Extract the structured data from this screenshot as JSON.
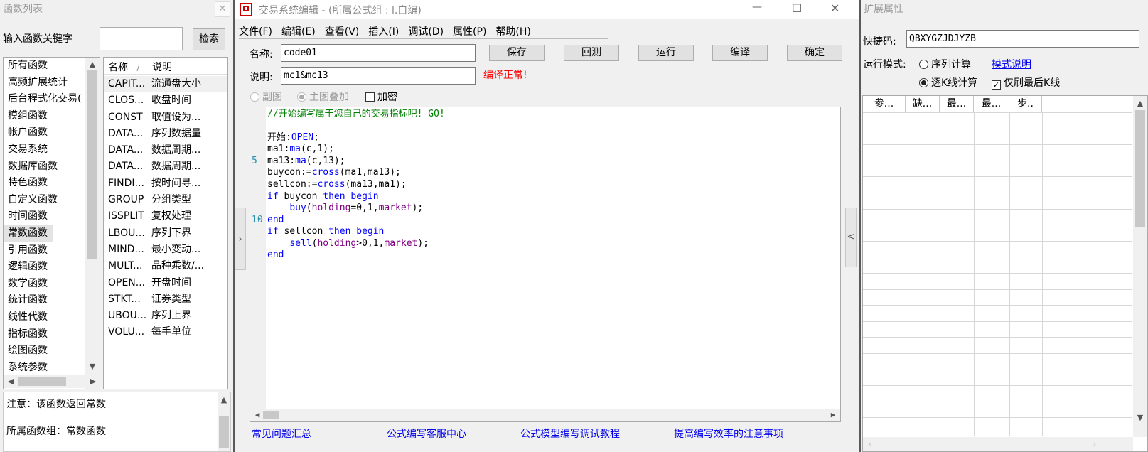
{
  "left_panel": {
    "title": "函数列表",
    "close_glyph": "✕",
    "keyword_label": "输入函数关键字",
    "keyword_value": "",
    "search_button": "检索",
    "categories": [
      "所有函数",
      "高频扩展统计",
      "后台程式化交易(",
      "模组函数",
      "帐户函数",
      "交易系统",
      "数据库函数",
      "特色函数",
      "自定义函数",
      "时间函数",
      "常数函数",
      "引用函数",
      "逻辑函数",
      "数学函数",
      "统计函数",
      "线性代数",
      "指标函数",
      "绘图函数",
      "系统参数"
    ],
    "selected_category": "常数函数",
    "columns": {
      "name": "名称",
      "sort_glyph": "/",
      "desc": "说明"
    },
    "functions": [
      {
        "name": "CAPIT...",
        "desc": "流通盘大小"
      },
      {
        "name": "CLOS...",
        "desc": "收盘时间"
      },
      {
        "name": "CONST",
        "desc": "取值设为..."
      },
      {
        "name": "DATA...",
        "desc": "序列数据量"
      },
      {
        "name": "DATA...",
        "desc": "数据周期..."
      },
      {
        "name": "DATA...",
        "desc": "数据周期..."
      },
      {
        "name": "FINDI...",
        "desc": "按时间寻..."
      },
      {
        "name": "GROUP",
        "desc": "分组类型"
      },
      {
        "name": "ISSPLIT",
        "desc": "复权处理"
      },
      {
        "name": "LBOU...",
        "desc": "序列下界"
      },
      {
        "name": "MIND...",
        "desc": "最小变动..."
      },
      {
        "name": "MULT...",
        "desc": "品种乘数/..."
      },
      {
        "name": "OPEN...",
        "desc": "开盘时间"
      },
      {
        "name": "STKT...",
        "desc": "证券类型"
      },
      {
        "name": "UBOU...",
        "desc": "序列上界"
      },
      {
        "name": "VOLU...",
        "desc": "每手单位"
      }
    ],
    "note_line1": "注意：该函数返回常数",
    "note_line2": "所属函数组：常数函数"
  },
  "editor": {
    "title": "交易系统编辑 - (所属公式组 : l.自编)",
    "window_controls": {
      "minimize": "—",
      "maximize": "☐",
      "close": "✕"
    },
    "menu": [
      "文件(F)",
      "编辑(E)",
      "查看(V)",
      "插入(I)",
      "调试(D)",
      "属性(P)",
      "帮助(H)"
    ],
    "name_label": "名称:",
    "name_value": "code01",
    "desc_label": "说明:",
    "desc_value": "mc1&mc13",
    "buttons": {
      "save": "保存",
      "backtest": "回测",
      "run": "运行",
      "compile": "编译",
      "ok": "确定"
    },
    "compile_status": "编译正常!",
    "options": {
      "sub_chart": "副图",
      "main_overlay": "主图叠加",
      "encrypt": "加密"
    },
    "line_numbers": [
      "5",
      "10"
    ],
    "expand_glyph": "<",
    "links": [
      "常见问题汇总",
      "公式编写客服中心",
      "公式模型编写调试教程",
      "提高编写效率的注意事项"
    ]
  },
  "right_panel": {
    "title": "扩展属性",
    "shortcut_label": "快捷码:",
    "shortcut_value": "QBXYGZJDJYZB",
    "mode_label": "运行模式:",
    "mode_seq": "序列计算",
    "mode_explain": "模式说明",
    "mode_bar": "逐K线计算",
    "refresh_last": "仅刷最后K线",
    "grid_headers": [
      "参...",
      "缺...",
      "最...",
      "最...",
      "步.."
    ]
  },
  "colors": {
    "link": "#0000ee",
    "status_red": "#ff0000",
    "keyword_blue": "#0000ff",
    "comment_green": "#008000",
    "param_purple": "#800080"
  }
}
